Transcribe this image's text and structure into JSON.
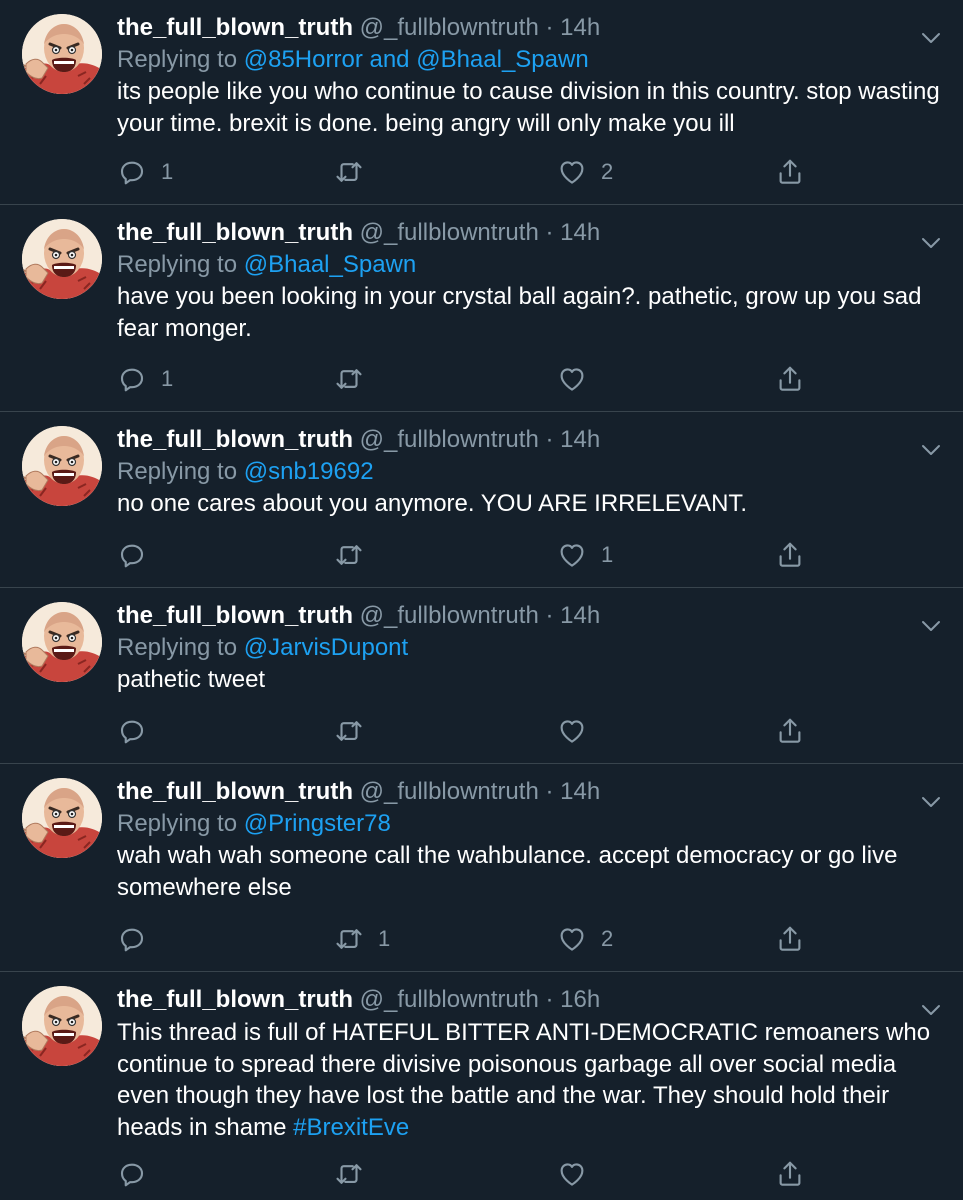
{
  "tweets": [
    {
      "author": "the_full_blown_truth",
      "handle": "@_fullblowntruth",
      "separator": "·",
      "time": "14h",
      "replying_prefix": "Replying to",
      "mentions": [
        "@85Horror",
        "@Bhaal_Spawn"
      ],
      "mention_joiner": "and",
      "text": "its people like you who continue to cause division in this country. stop wasting your time. brexit is done. being angry will only make you ill",
      "hashtag": "",
      "replies": "1",
      "retweets": "",
      "likes": "2"
    },
    {
      "author": "the_full_blown_truth",
      "handle": "@_fullblowntruth",
      "separator": "·",
      "time": "14h",
      "replying_prefix": "Replying to",
      "mentions": [
        "@Bhaal_Spawn"
      ],
      "mention_joiner": "",
      "text": "have you been looking in your crystal ball again?. pathetic, grow up you sad fear monger.",
      "hashtag": "",
      "replies": "1",
      "retweets": "",
      "likes": ""
    },
    {
      "author": "the_full_blown_truth",
      "handle": "@_fullblowntruth",
      "separator": "·",
      "time": "14h",
      "replying_prefix": "Replying to",
      "mentions": [
        "@snb19692"
      ],
      "mention_joiner": "",
      "text": "no one cares about you anymore. YOU ARE IRRELEVANT.",
      "hashtag": "",
      "replies": "",
      "retweets": "",
      "likes": "1"
    },
    {
      "author": "the_full_blown_truth",
      "handle": "@_fullblowntruth",
      "separator": "·",
      "time": "14h",
      "replying_prefix": "Replying to",
      "mentions": [
        "@JarvisDupont"
      ],
      "mention_joiner": "",
      "text": "pathetic tweet",
      "hashtag": "",
      "replies": "",
      "retweets": "",
      "likes": ""
    },
    {
      "author": "the_full_blown_truth",
      "handle": "@_fullblowntruth",
      "separator": "·",
      "time": "14h",
      "replying_prefix": "Replying to",
      "mentions": [
        "@Pringster78"
      ],
      "mention_joiner": "",
      "text": "wah wah wah someone call the wahbulance. accept democracy or go live somewhere else",
      "hashtag": "",
      "replies": "",
      "retweets": "1",
      "likes": "2"
    },
    {
      "author": "the_full_blown_truth",
      "handle": "@_fullblowntruth",
      "separator": "·",
      "time": "16h",
      "replying_prefix": "",
      "mentions": [],
      "mention_joiner": "",
      "text": "This thread is full of HATEFUL BITTER ANTI-DEMOCRATIC remoaners who continue to spread there divisive poisonous garbage all over social media even though they have lost the battle and the war. They should hold their heads in shame",
      "hashtag": "#BrexitEve",
      "replies": "",
      "retweets": "",
      "likes": ""
    }
  ],
  "colors": {
    "background": "#15202b",
    "divider": "#38444d",
    "secondary_text": "#8899a6",
    "link": "#1da1f2",
    "primary_text": "#ffffff"
  },
  "icons": {
    "avatar": "cartoon-angry-man-avatar",
    "more": "chevron-down-icon",
    "reply": "reply-icon",
    "retweet": "retweet-icon",
    "like": "heart-icon",
    "share": "share-icon"
  }
}
